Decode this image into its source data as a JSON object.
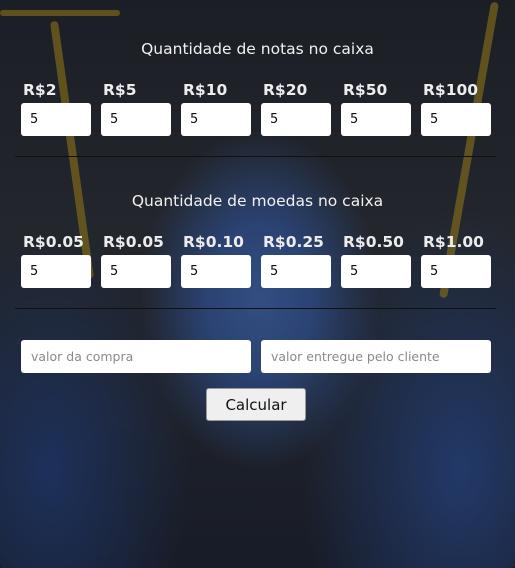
{
  "notes": {
    "heading": "Quantidade de notas no caixa",
    "items": [
      {
        "label": "R$2",
        "value": "5"
      },
      {
        "label": "R$5",
        "value": "5"
      },
      {
        "label": "R$10",
        "value": "5"
      },
      {
        "label": "R$20",
        "value": "5"
      },
      {
        "label": "R$50",
        "value": "5"
      },
      {
        "label": "R$100",
        "value": "5"
      }
    ]
  },
  "coins": {
    "heading": "Quantidade de moedas no caixa",
    "items": [
      {
        "label": "R$0.05",
        "value": "5"
      },
      {
        "label": "R$0.05",
        "value": "5"
      },
      {
        "label": "R$0.10",
        "value": "5"
      },
      {
        "label": "R$0.25",
        "value": "5"
      },
      {
        "label": "R$0.50",
        "value": "5"
      },
      {
        "label": "R$1.00",
        "value": "5"
      }
    ]
  },
  "payment": {
    "purchase_placeholder": "valor da compra",
    "received_placeholder": "valor entregue pelo cliente"
  },
  "actions": {
    "calculate_label": "Calcular"
  }
}
